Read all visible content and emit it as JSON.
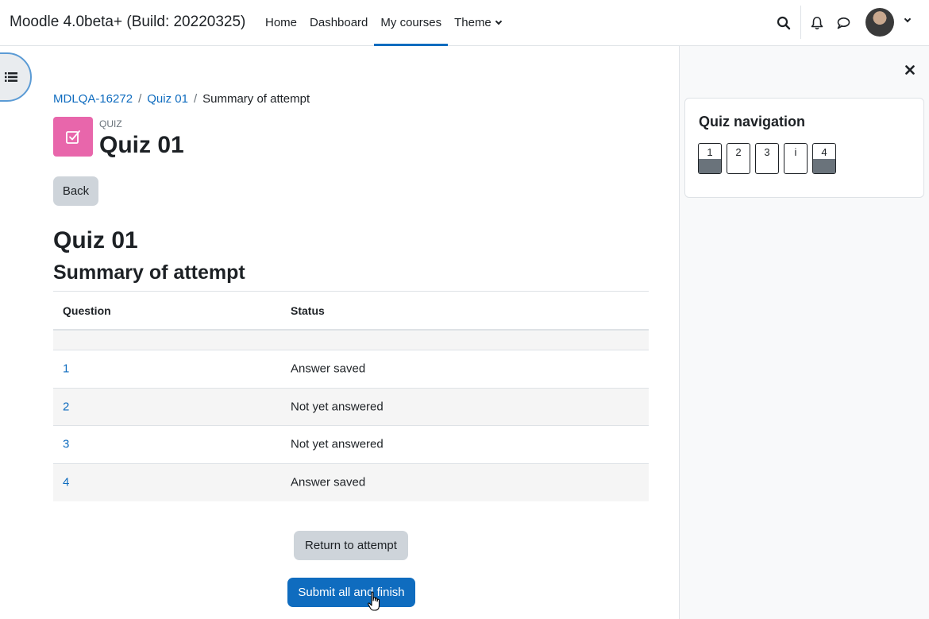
{
  "navbar": {
    "brand": "Moodle 4.0beta+ (Build: 20220325)",
    "items": [
      {
        "label": "Home"
      },
      {
        "label": "Dashboard"
      },
      {
        "label": "My courses",
        "active": true
      },
      {
        "label": "Theme"
      }
    ],
    "icons": [
      "search-icon",
      "bell-icon",
      "chat-icon",
      "avatar",
      "chevron-down-icon"
    ]
  },
  "breadcrumb": {
    "items": [
      "MDLQA-16272",
      "Quiz 01",
      "Summary of attempt"
    ]
  },
  "module": {
    "type": "QUIZ",
    "title": "Quiz 01",
    "icon": "quiz-checkbox-icon",
    "icon_color": "#e866ab"
  },
  "buttons": {
    "back": "Back",
    "return": "Return to attempt",
    "submit": "Submit all and finish"
  },
  "headings": {
    "quiz": "Quiz 01",
    "summary": "Summary of attempt"
  },
  "table": {
    "headers": [
      "Question",
      "Status"
    ],
    "rows": [
      {
        "question": "1",
        "status": "Answer saved"
      },
      {
        "question": "2",
        "status": "Not yet answered"
      },
      {
        "question": "3",
        "status": "Not yet answered"
      },
      {
        "question": "4",
        "status": "Answer saved"
      }
    ]
  },
  "quiz_navigation": {
    "title": "Quiz navigation",
    "buttons": [
      {
        "label": "1",
        "answered": true
      },
      {
        "label": "2",
        "answered": false
      },
      {
        "label": "3",
        "answered": false
      },
      {
        "label": "i",
        "answered": false
      },
      {
        "label": "4",
        "answered": true
      }
    ]
  },
  "colors": {
    "primary": "#0f6cbf",
    "secondary_button": "#ced4da",
    "answered_fill": "#6a737b"
  }
}
